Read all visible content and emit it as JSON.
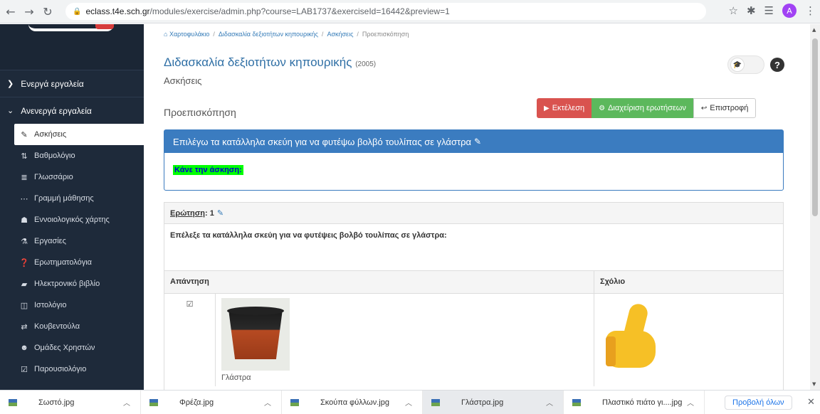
{
  "browser": {
    "url_host": "eclass.t4e.sch.gr",
    "url_path": "/modules/exercise/admin.php?course=LAB1737&exerciseId=16442&preview=1",
    "profile_initial": "A"
  },
  "sidebar": {
    "sections": {
      "active_tools": "Ενεργά εργαλεία",
      "inactive_tools": "Ανενεργά εργαλεία"
    },
    "items": [
      {
        "label": "Ασκήσεις",
        "icon": "edit-icon"
      },
      {
        "label": "Βαθμολόγιο",
        "icon": "sort-numeric-icon"
      },
      {
        "label": "Γλωσσάριο",
        "icon": "list-icon"
      },
      {
        "label": "Γραμμή μάθησης",
        "icon": "ellipsis-icon"
      },
      {
        "label": "Εννοιολογικός χάρτης",
        "icon": "sitemap-icon"
      },
      {
        "label": "Εργασίες",
        "icon": "flask-icon"
      },
      {
        "label": "Ερωτηματολόγια",
        "icon": "question-circle-icon"
      },
      {
        "label": "Ηλεκτρονικό βιβλίο",
        "icon": "book-icon"
      },
      {
        "label": "Ιστολόγιο",
        "icon": "columns-icon"
      },
      {
        "label": "Κουβεντούλα",
        "icon": "exchange-icon"
      },
      {
        "label": "Ομάδες Χρηστών",
        "icon": "users-icon"
      },
      {
        "label": "Παρουσιολόγιο",
        "icon": "checkbox-icon"
      }
    ]
  },
  "breadcrumb": {
    "home": "Χαρτοφυλάκιο",
    "course": "Διδασκαλία δεξιοτήτων κηπουρικής",
    "section": "Ασκήσεις",
    "current": "Προεπισκόπηση"
  },
  "course": {
    "title": "Διδασκαλία δεξιοτήτων κηπουρικής",
    "code": "(2005)",
    "subtitle": "Ασκήσεις"
  },
  "preview_title": "Προεπισκόπηση",
  "buttons": {
    "execute": "Εκτέλεση",
    "manage_questions": "Διαχείριση ερωτήσεων",
    "back": "Επιστροφή"
  },
  "exercise": {
    "title": "Επιλέγω τα κατάλληλα σκεύη για να φυτέψω βολβό τουλίπας σε γλάστρα",
    "instruction": "Κάνε την άσκηση:"
  },
  "question": {
    "label": "Ερώτηση",
    "number": ": 1",
    "text": "Επέλεξε τα κατάλληλα σκεύη για να φυτέψεις βολβό τουλίπας σε γλάστρα:",
    "col_answer": "Απάντηση",
    "col_comment": "Σχόλιο",
    "answer_caption": "Γλάστρα"
  },
  "downloads": {
    "items": [
      "Σωστό.jpg",
      "Φρέζα.jpg",
      "Σκούπα φύλλων.jpg",
      "Γλάστρα.jpg",
      "Πλαστικό πιάτο γι....jpg"
    ],
    "show_all": "Προβολή όλων"
  },
  "colors": {
    "sidebar_bg": "#1e2a3a",
    "panel_header": "#3b7cc0",
    "btn_execute": "#d9534f",
    "btn_manage": "#5cb85c",
    "highlight": "#00ff00"
  }
}
